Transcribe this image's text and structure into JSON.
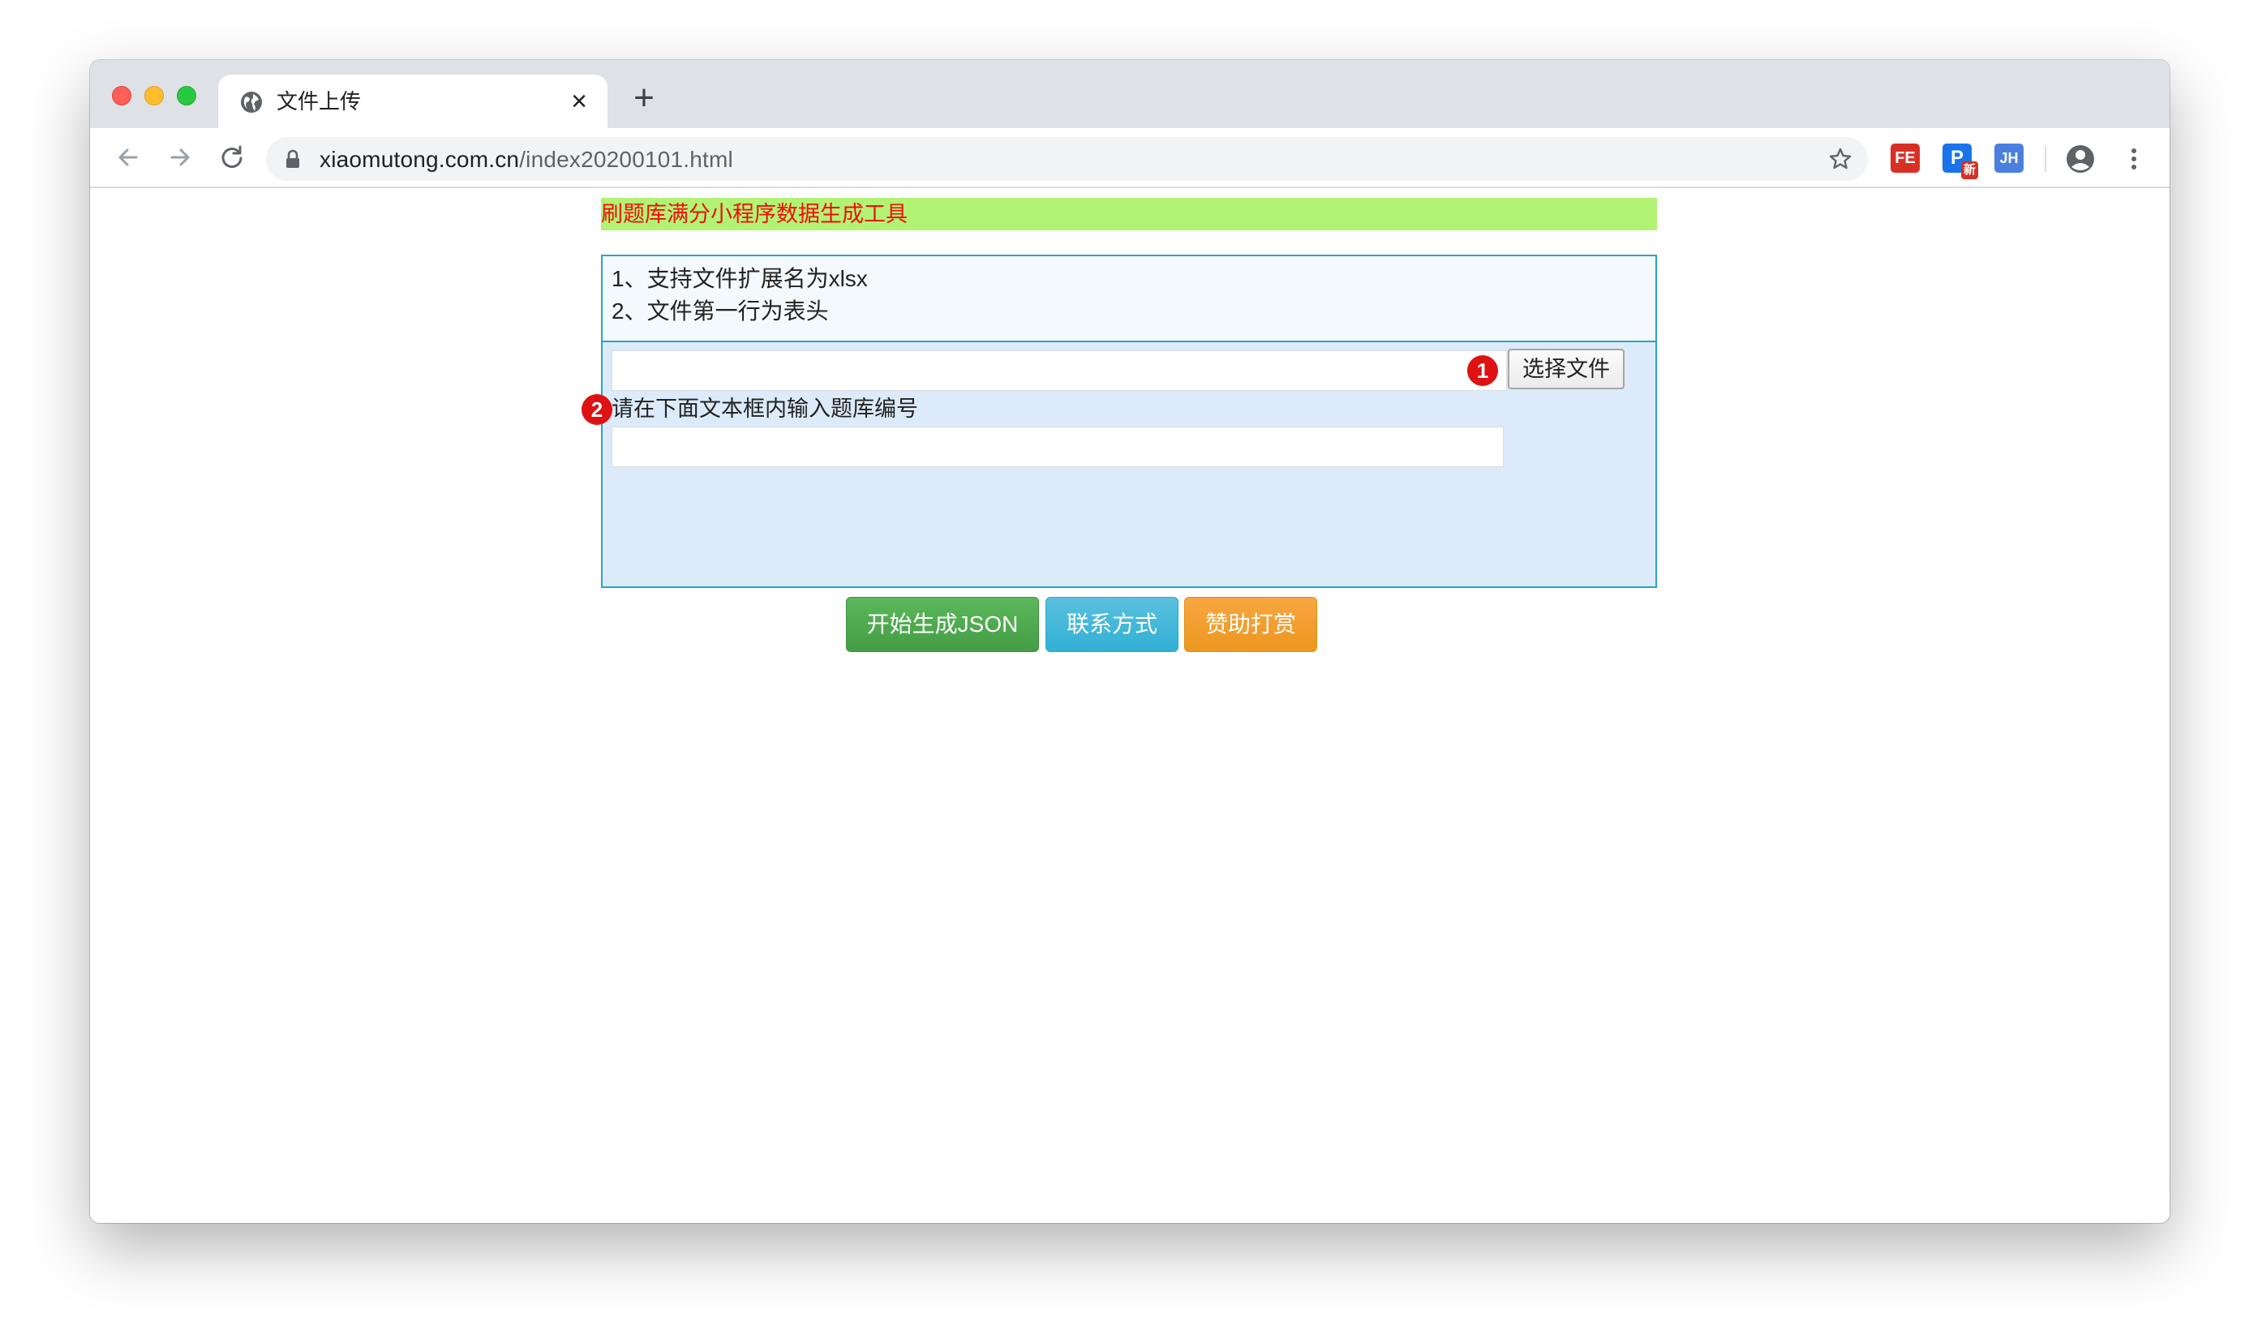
{
  "browser": {
    "tab_title": "文件上传",
    "url_host": "xiaomutong.com.cn",
    "url_path": "/index20200101.html",
    "extensions": {
      "fe": "FE",
      "p": "P",
      "p_badge": "新",
      "jh": "JH"
    }
  },
  "page": {
    "title": "刷题库满分小程序数据生成工具",
    "info_lines": [
      "1、支持文件扩展名为xlsx",
      "2、文件第一行为表头"
    ],
    "file_input_value": "",
    "choose_file_label": "选择文件",
    "marker_1": "1",
    "marker_2": "2",
    "id_label": "请在下面文本框内输入题库编号",
    "id_input_value": "",
    "buttons": {
      "generate": "开始生成JSON",
      "contact": "联系方式",
      "donate": "赞助打赏"
    }
  },
  "colors": {
    "title_bg": "#b2f374",
    "title_text": "#f20d0d",
    "panel_border": "#29a3c9",
    "form_bg": "#dceafa",
    "generate": "#5cb85c",
    "contact": "#5bc0de",
    "donate": "#f0ad4e",
    "marker": "#de1212"
  },
  "icons": {
    "tab": "globe-icon",
    "back": "arrow-left-icon",
    "forward": "arrow-right-icon",
    "reload": "reload-icon",
    "lock": "lock-icon",
    "bookmark": "star-icon",
    "profile": "account-icon",
    "menu": "kebab-menu-icon"
  }
}
